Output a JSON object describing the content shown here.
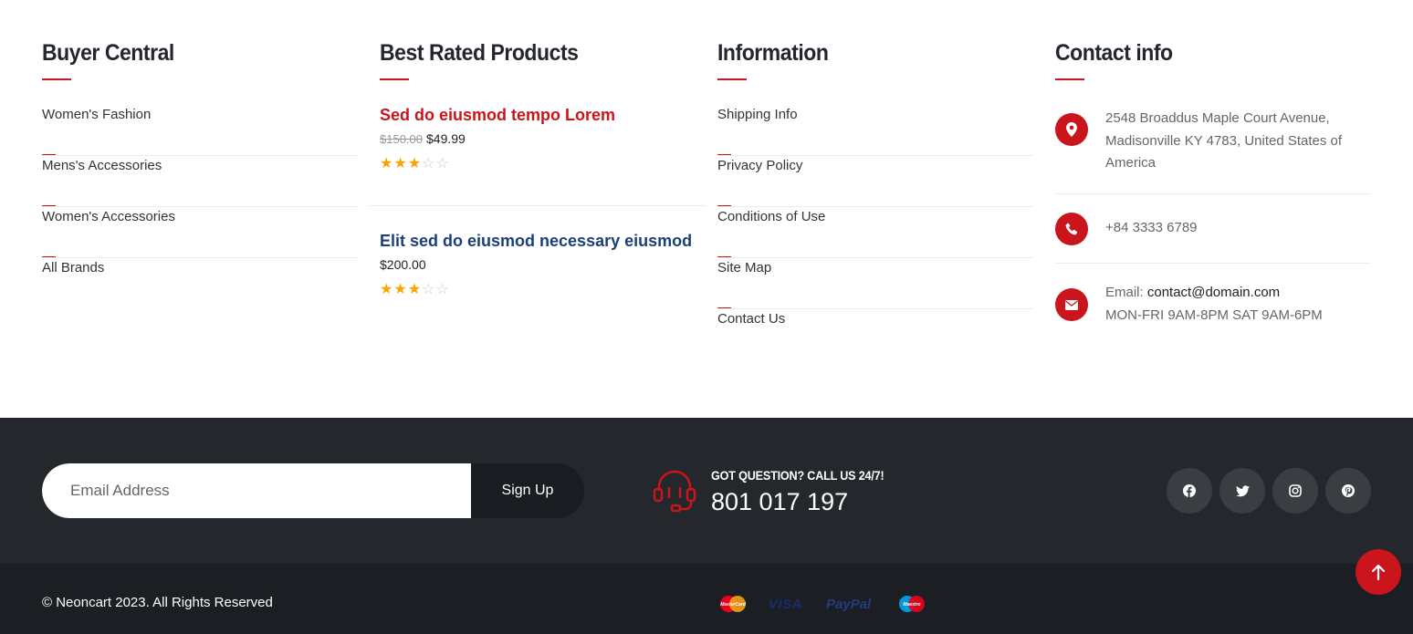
{
  "columns": {
    "buyer": {
      "title": "Buyer Central",
      "links": [
        "Women's Fashion",
        "Mens's Accessories",
        "Women's Accessories",
        "All Brands"
      ]
    },
    "products": {
      "title": "Best Rated Products",
      "items": [
        {
          "name": "Sed do eiusmod tempo Lorem",
          "old_price": "$150.00",
          "price": "$49.99",
          "rating": 3,
          "rating_max": 5
        },
        {
          "name": "Elit sed do eiusmod necessary eiusmod",
          "old_price": "",
          "price": "$200.00",
          "rating": 3,
          "rating_max": 5
        }
      ]
    },
    "information": {
      "title": "Information",
      "links": [
        "Shipping Info",
        "Privacy Policy",
        "Conditions of Use",
        "Site Map",
        "Contact Us"
      ]
    },
    "contact": {
      "title": "Contact info",
      "address": "2548 Broaddus Maple Court Avenue, Madisonville KY 4783, United States of America",
      "phone": "+84 3333 6789",
      "email_label": "Email:",
      "email": "contact@domain.com",
      "hours": "MON-FRI 9AM-8PM SAT 9AM-6PM"
    }
  },
  "newsletter": {
    "placeholder": "Email Address",
    "button": "Sign Up"
  },
  "support": {
    "title": "GOT QUESTION? CALL US 24/7!",
    "phone": "801 017 197"
  },
  "social": [
    "facebook-icon",
    "twitter-icon",
    "instagram-icon",
    "pinterest-icon"
  ],
  "footer": {
    "copyright": "© Neoncart 2023. All Rights Reserved",
    "payments": {
      "mastercard": "MasterCard",
      "visa": "VISA",
      "paypal": "PayPal",
      "maestro": "Maestro"
    }
  },
  "colors": {
    "accent": "#c9151b",
    "dark_band": "#24282d",
    "bottom_bar": "#1b1e22",
    "link_blue": "#1b3f78",
    "star": "#f7a600"
  }
}
